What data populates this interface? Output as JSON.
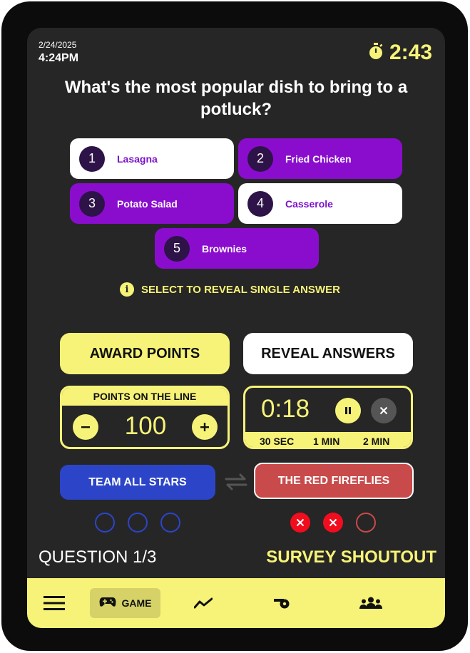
{
  "status": {
    "date": "2/24/2025",
    "time": "4:24PM",
    "round_timer": "2:43"
  },
  "question": {
    "text": "What's the most popular dish to bring to a potluck?"
  },
  "answers": [
    {
      "num": "1",
      "label": "Lasagna"
    },
    {
      "num": "2",
      "label": "Fried Chicken"
    },
    {
      "num": "3",
      "label": "Potato Salad"
    },
    {
      "num": "4",
      "label": "Casserole"
    },
    {
      "num": "5",
      "label": "Brownies"
    }
  ],
  "hint": "SELECT TO REVEAL SINGLE ANSWER",
  "actions": {
    "award": "AWARD POINTS",
    "reveal": "REVEAL ANSWERS"
  },
  "points": {
    "header": "POINTS ON THE LINE",
    "value": "100"
  },
  "countdown": {
    "value": "0:18",
    "options": [
      "30 SEC",
      "1 MIN",
      "2 MIN"
    ]
  },
  "teams": [
    {
      "name": "TEAM ALL STARS",
      "color": "#2c45c8",
      "strikes": [
        false,
        false,
        false
      ]
    },
    {
      "name": "THE RED FIREFLIES",
      "color": "#c94a4a",
      "strikes": [
        true,
        true,
        false
      ]
    }
  ],
  "footer": {
    "question_progress": "QUESTION 1/3",
    "game_name": "SURVEY SHOUTOUT"
  },
  "nav": {
    "game_label": "GAME",
    "icons": [
      "menu-icon",
      "gamepad-icon",
      "chart-line-icon",
      "whistle-icon",
      "group-icon"
    ]
  },
  "colors": {
    "accent": "#f7f378",
    "purple": "#8a0dce",
    "blue_team": "#2c45c8",
    "red_team": "#c94a4a",
    "background": "#262626"
  }
}
